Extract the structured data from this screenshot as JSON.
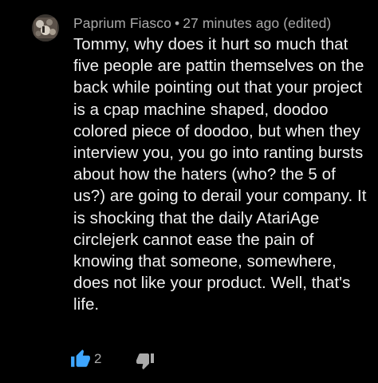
{
  "comment": {
    "author": "Paprium Fiasco",
    "separator": "•",
    "timestamp": "27 minutes ago (edited)",
    "text": "Tommy, why does it hurt so much that five people are pattin themselves on the back while pointing out that your project is a cpap machine shaped, doodoo colored piece of doodoo, but when they interview you, you go into ranting bursts about how the haters (who? the 5 of us?) are going to derail your company. It is shocking that the daily AtariAge circlejerk cannot ease the pain of knowing that someone, somewhere, does not like your product. Well, that's life.",
    "like_count": "2"
  },
  "icons": {
    "avatar": "user-avatar",
    "like": "thumbs-up-icon",
    "dislike": "thumbs-down-icon"
  },
  "colors": {
    "background": "#000000",
    "meta_text": "#aaaaaa",
    "body_text": "#f1f1f1",
    "like_active": "#3ea6ff",
    "dislike": "#aaaaaa"
  }
}
